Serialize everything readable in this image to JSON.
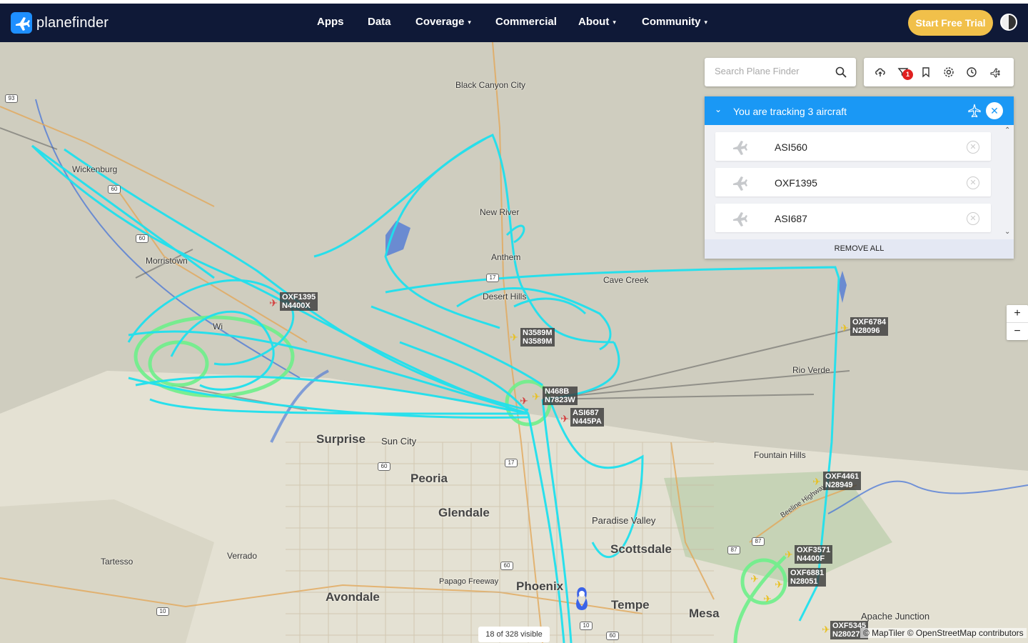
{
  "header": {
    "brand": "planefinder",
    "nav": [
      {
        "label": "Apps",
        "dropdown": false
      },
      {
        "label": "Data",
        "dropdown": false
      },
      {
        "label": "Coverage",
        "dropdown": true
      },
      {
        "label": "Commercial",
        "dropdown": false
      },
      {
        "label": "About",
        "dropdown": true
      },
      {
        "label": "Community",
        "dropdown": true
      }
    ],
    "cta": "Start Free Trial"
  },
  "search": {
    "placeholder": "Search Plane Finder"
  },
  "toolbar": {
    "filter_badge": "1"
  },
  "tracking": {
    "title": "You are tracking 3 aircraft",
    "items": [
      {
        "callsign": "ASI560"
      },
      {
        "callsign": "OXF1395"
      },
      {
        "callsign": "ASI687"
      }
    ],
    "remove_all": "REMOVE ALL"
  },
  "map": {
    "places": [
      {
        "name": "Black Canyon City"
      },
      {
        "name": "Wickenburg"
      },
      {
        "name": "New River"
      },
      {
        "name": "Morristown"
      },
      {
        "name": "Anthem"
      },
      {
        "name": "Cave Creek"
      },
      {
        "name": "Desert Hills"
      },
      {
        "name": "Rio Verde"
      },
      {
        "name": "Surprise"
      },
      {
        "name": "Sun City"
      },
      {
        "name": "Fountain Hills"
      },
      {
        "name": "Peoria"
      },
      {
        "name": "Glendale"
      },
      {
        "name": "Paradise Valley"
      },
      {
        "name": "Tartesso"
      },
      {
        "name": "Verrado"
      },
      {
        "name": "Scottsdale"
      },
      {
        "name": "Papago Freeway"
      },
      {
        "name": "Avondale"
      },
      {
        "name": "Phoenix"
      },
      {
        "name": "Tempe"
      },
      {
        "name": "Mesa"
      },
      {
        "name": "Apache Junction"
      },
      {
        "name": "Beeline Highway"
      },
      {
        "name": "Wi"
      }
    ],
    "routes": [
      "93",
      "60",
      "60",
      "17",
      "60",
      "17",
      "10",
      "60",
      "87",
      "87",
      "10",
      "10",
      "60"
    ],
    "aircraft": [
      {
        "id": "OXF1395",
        "reg": "N4400X",
        "color": "#d43a3a"
      },
      {
        "id": "N3589M",
        "reg": "N3589M",
        "color": "#e8c020"
      },
      {
        "id": "N468B",
        "reg": "N7823W",
        "color": "#e8c020"
      },
      {
        "id": "ASI687",
        "reg": "N445PA",
        "color": "#d43a3a"
      },
      {
        "id": "OXF6784",
        "reg": "N28096",
        "color": "#e8c020"
      },
      {
        "id": "OXF4461",
        "reg": "N28949",
        "color": "#e8c020"
      },
      {
        "id": "OXF3571",
        "reg": "N4400F",
        "color": "#e8c020"
      },
      {
        "id": "OXF6881",
        "reg": "N28051",
        "color": "#e8c020"
      },
      {
        "id": "OXF5345",
        "reg": "N28027",
        "color": "#e8c020"
      }
    ],
    "visible_count": "18 of 328 visible",
    "attribution": "© MapTiler © OpenStreetMap contributors",
    "zoom_in": "+",
    "zoom_out": "−"
  },
  "colors": {
    "nav_bg": "#0f1937",
    "accent": "#1a98f5",
    "cta": "#f1c04a",
    "track_cyan": "#1fe0ee",
    "track_green": "#6ef08a"
  }
}
